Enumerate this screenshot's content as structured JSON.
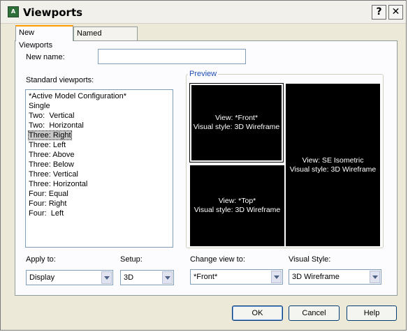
{
  "window": {
    "title": "Viewports",
    "help_glyph": "?",
    "close_glyph": "✕",
    "app_icon_text": "A"
  },
  "tabs": [
    {
      "label": "New Viewports",
      "active": true
    },
    {
      "label": "Named Viewports",
      "active": false
    }
  ],
  "new_name": {
    "label": "New name:",
    "value": ""
  },
  "standard": {
    "label": "Standard viewports:",
    "items": [
      "*Active Model Configuration*",
      "Single",
      "Two:  Vertical",
      "Two:  Horizontal",
      "Three: Right",
      "Three: Left",
      "Three: Above",
      "Three: Below",
      "Three: Vertical",
      "Three: Horizontal",
      "Four: Equal",
      "Four: Right",
      "Four:  Left"
    ],
    "selected_index": 4
  },
  "preview": {
    "label": "Preview",
    "front": {
      "view": "View: *Front*",
      "style": "Visual style: 3D Wireframe"
    },
    "top": {
      "view": "View: *Top*",
      "style": "Visual style: 3D Wireframe"
    },
    "se": {
      "view": "View: SE Isometric",
      "style": "Visual style: 3D Wireframe"
    }
  },
  "apply_to": {
    "label": "Apply to:",
    "value": "Display"
  },
  "setup": {
    "label": "Setup:",
    "value": "3D"
  },
  "change_view": {
    "label": "Change view to:",
    "value": "*Front*"
  },
  "visual_style": {
    "label": "Visual Style:",
    "value": "3D Wireframe"
  },
  "buttons": {
    "ok": "OK",
    "cancel": "Cancel",
    "help": "Help"
  }
}
